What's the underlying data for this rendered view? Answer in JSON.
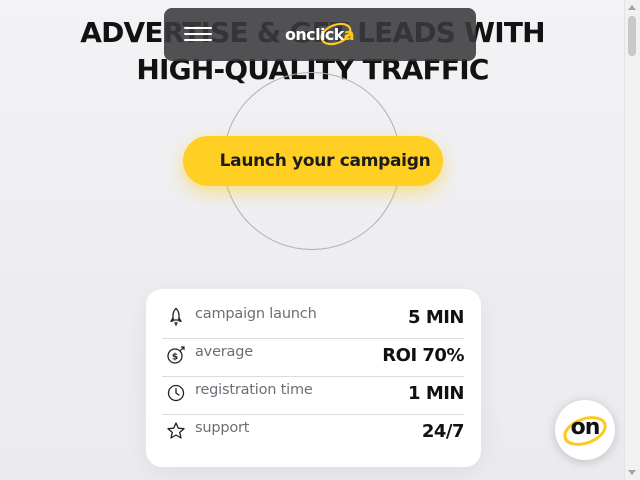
{
  "hero": {
    "headline_line1": "ADVERTISE & GET LEADS WITH",
    "headline_line2": "HIGH-QUALITY TRAFFIC",
    "cta_label": "Launch your campaign"
  },
  "navbar": {
    "logo_text_main": "onclick",
    "logo_text_accent": "a",
    "menu_icon": "hamburger-menu-icon"
  },
  "stats": [
    {
      "icon": "rocket-icon",
      "label": "campaign launch",
      "value": "5 MIN"
    },
    {
      "icon": "dollar-coin-icon",
      "label": "average",
      "value": "ROI 70%"
    },
    {
      "icon": "clock-icon",
      "label": "registration time",
      "value": "1 MIN"
    },
    {
      "icon": "star-icon",
      "label": "support",
      "value": "24/7"
    }
  ],
  "badge": {
    "text": "on"
  },
  "colors": {
    "accent": "#ffcf23",
    "navbar_bg": "#3a3a3e",
    "text_dark": "#111111",
    "label_gray": "#6e6e76"
  }
}
